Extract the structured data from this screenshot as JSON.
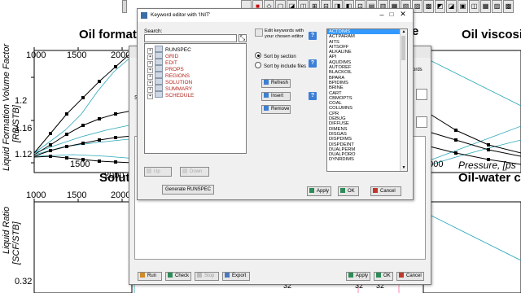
{
  "background": {
    "titles": {
      "oil_formation": "Oil formati",
      "oil_viscosity": "Oil viscosit",
      "solution": "Solutic",
      "oil_water": "Oil-water co"
    },
    "top_x_ticks": [
      "1000",
      "1500",
      "2000"
    ],
    "top_y_ticks": [
      "1.2",
      "1.16",
      "1.12"
    ],
    "mid_x_ticks": [
      "1500",
      "2000"
    ],
    "right_x_ticks": [
      "2000",
      "2000"
    ],
    "lower_x_ticks": [
      "1000",
      "1500",
      "2000"
    ],
    "lower_y_tick": "0.32",
    "left_vlabel_1": "Liquid Formation Volume Factor",
    "left_vlabel_2": "[RB/STB]",
    "left_vlabel_3": "Liquid Ratio",
    "left_vlabel_4": "[SCF/STB]",
    "pressure_label": "Pressure, [ps",
    "right_tick_fragment": "e",
    "right_axis_fragments": [
      "32",
      "32",
      "32"
    ]
  },
  "behind_window": {
    "side_label": "Se",
    "right_label": "ords",
    "buttons": {
      "run": "Run",
      "check": "Check",
      "stop": "Stop",
      "export": "Export",
      "apply": "Apply",
      "ok": "OK",
      "cancel": "Cancel"
    }
  },
  "dialog": {
    "title": "Keyword editor with 'INIT'",
    "search_label": "Search:",
    "search_value": "",
    "tree": [
      {
        "label": "RUNSPEC",
        "color": "#000000"
      },
      {
        "label": "GRID",
        "color": "#b3261e"
      },
      {
        "label": "EDIT",
        "color": "#b3261e"
      },
      {
        "label": "PROPS",
        "color": "#b3261e"
      },
      {
        "label": "REGIONS",
        "color": "#b3261e"
      },
      {
        "label": "SOLUTION",
        "color": "#b3261e"
      },
      {
        "label": "SUMMARY",
        "color": "#b3261e"
      },
      {
        "label": "SCHEDULE",
        "color": "#b3261e"
      }
    ],
    "edit_hint_line1": "Edit keywords with",
    "edit_hint_line2": "your chosen editor",
    "sort_by_section": "Sort by section",
    "sort_by_include": "Sort by include files",
    "refresh": "Refresh",
    "insert": "Insert",
    "remove": "Remove",
    "up": "Up",
    "down": "Down",
    "generate": "Generate RUNSPEC",
    "apply": "Apply",
    "ok": "OK",
    "cancel": "Cancel",
    "keywords": [
      "ACTDIMS",
      "ACTPARAM",
      "AITS",
      "AITSOFF",
      "ALKALINE",
      "API",
      "AQUDIMS",
      "AUTOREF",
      "BLACKOIL",
      "BPARA",
      "BPIDIMS",
      "BRINE",
      "CART",
      "CBMOPTS",
      "COAL",
      "COLUMNS",
      "CPR",
      "DEBUG",
      "DIFFUSE",
      "DIMENS",
      "DISGAS",
      "DISPDIMS",
      "DISPDEINT",
      "DUALPERM",
      "DUALPORO",
      "DYNRDIMS"
    ],
    "selected_keyword": "ACTDIMS"
  },
  "colors": {
    "curve": "#2aa7b8",
    "tree_red": "#b3261e",
    "selection": "#3399ff",
    "help": "#3c7fd8"
  }
}
